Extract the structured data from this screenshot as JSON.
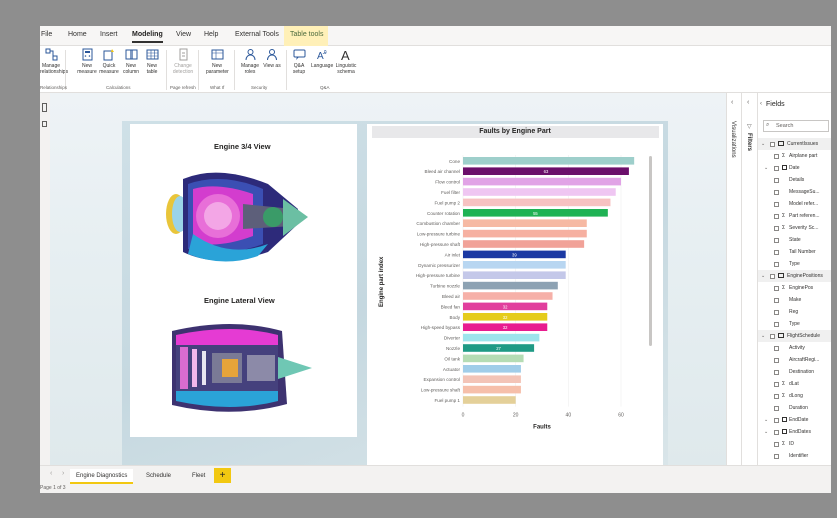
{
  "ribbon": {
    "tabs": [
      "File",
      "Home",
      "Insert",
      "Modeling",
      "View",
      "Help",
      "External Tools",
      "Table tools"
    ],
    "active_tab": "Modeling",
    "buttons": [
      {
        "label": "Manage relationships",
        "icon": "relationships-icon"
      },
      {
        "label": "New measure",
        "icon": "calculator-icon"
      },
      {
        "label": "Quick measure",
        "icon": "quick-measure-icon"
      },
      {
        "label": "New column",
        "icon": "column-icon"
      },
      {
        "label": "New table",
        "icon": "table-icon"
      },
      {
        "label": "Change detection",
        "icon": "change-detection-icon",
        "disabled": true
      },
      {
        "label": "New parameter",
        "icon": "parameter-icon"
      },
      {
        "label": "Manage roles",
        "icon": "roles-icon"
      },
      {
        "label": "View as",
        "icon": "view-as-icon"
      },
      {
        "label": "Q&A setup",
        "icon": "qa-setup-icon"
      },
      {
        "label": "Language",
        "icon": "language-icon"
      },
      {
        "label": "Linguistic schema",
        "icon": "linguistic-schema-icon"
      }
    ],
    "groups": [
      "Relationships",
      "Calculations",
      "Page refresh",
      "What If",
      "Security",
      "Q&A"
    ]
  },
  "report": {
    "left_visual": {
      "title1": "Engine 3/4 View",
      "title2": "Engine Lateral View"
    },
    "chart_data": {
      "type": "bar",
      "orientation": "horizontal",
      "title": "Faults by Engine Part",
      "ylabel": "Engine part index",
      "xlabel": "Faults",
      "xlim": [
        0,
        60
      ],
      "xticks": [
        0,
        20,
        40,
        60
      ],
      "categories": [
        "Cone",
        "Bleed air channel",
        "Flow control",
        "Fuel filter",
        "Fuel pump 2",
        "Counter rotation",
        "Combustion chamber",
        "Low-pressure turbine",
        "High-pressure shaft",
        "Air inlet",
        "Dynamic pressurizer",
        "High-pressure turbine",
        "Turbine nozzle",
        "Bleed air",
        "Bleed fan",
        "Body",
        "High-speed bypass",
        "Diverter",
        "Nozzle",
        "Oil tank",
        "Actuator",
        "Expansion control",
        "Low-pressure shaft",
        "Fuel pump 1"
      ],
      "values": [
        65,
        63,
        60,
        58,
        56,
        55,
        47,
        47,
        46,
        39,
        39,
        39,
        36,
        34,
        32,
        32,
        32,
        29,
        27,
        23,
        22,
        22,
        22,
        20
      ],
      "data_labels": {
        "1": "63",
        "5": "55",
        "9": "39",
        "14": "32",
        "15": "32",
        "16": "32",
        "18": "27"
      },
      "colors": [
        "#9ecfcb",
        "#6b0f6b",
        "#e1a3e6",
        "#efc6f2",
        "#f7c2c2",
        "#1fb254",
        "#f6b9a3",
        "#f6b0a1",
        "#f1a298",
        "#1b39a3",
        "#b8d6f1",
        "#c4c8e9",
        "#8da2b3",
        "#f6b0a8",
        "#e13f9d",
        "#e5cc1c",
        "#e81c8f",
        "#9de4ec",
        "#1f9a85",
        "#b5dcb4",
        "#a0cde9",
        "#f3c4b7",
        "#f6bfaa",
        "#e4d099"
      ]
    }
  },
  "page_tabs": [
    "Engine Diagnostics",
    "Schedule",
    "Fleet"
  ],
  "active_page_tab": "Engine Diagnostics",
  "add_page_label": "+",
  "status": {
    "page_info": "Page 1 of 3"
  },
  "panes": {
    "visualizations": "Visualizations",
    "filters": "Filters"
  },
  "fields": {
    "title": "Fields",
    "search_placeholder": "Search",
    "tables": [
      {
        "name": "CurrentIssues",
        "expanded": true,
        "fields": [
          {
            "name": "Airplane part",
            "kind": "sigma"
          },
          {
            "name": "Date",
            "kind": "date",
            "expanded": true
          },
          {
            "name": "Details",
            "kind": "text"
          },
          {
            "name": "MessageSu...",
            "kind": "text"
          },
          {
            "name": "Model refer...",
            "kind": "text"
          },
          {
            "name": "Part referen...",
            "kind": "sigma"
          },
          {
            "name": "Severity Sc...",
            "kind": "sigma"
          },
          {
            "name": "State",
            "kind": "text"
          },
          {
            "name": "Tail Number",
            "kind": "text"
          },
          {
            "name": "Type",
            "kind": "text"
          }
        ]
      },
      {
        "name": "EnginePositions",
        "expanded": true,
        "fields": [
          {
            "name": "EnginePos",
            "kind": "sigma"
          },
          {
            "name": "Make",
            "kind": "text"
          },
          {
            "name": "Reg",
            "kind": "text"
          },
          {
            "name": "Type",
            "kind": "text"
          }
        ]
      },
      {
        "name": "FlightSchedule",
        "expanded": true,
        "fields": [
          {
            "name": "Activity",
            "kind": "text"
          },
          {
            "name": "AircraftRegi...",
            "kind": "text"
          },
          {
            "name": "Destination",
            "kind": "text"
          },
          {
            "name": "dLat",
            "kind": "sigma"
          },
          {
            "name": "dLong",
            "kind": "sigma"
          },
          {
            "name": "Duration",
            "kind": "text"
          },
          {
            "name": "EndDate",
            "kind": "date",
            "expanded": true
          },
          {
            "name": "EndDates",
            "kind": "date",
            "expanded": true
          },
          {
            "name": "ID",
            "kind": "sigma"
          },
          {
            "name": "Identifier",
            "kind": "text"
          }
        ]
      }
    ]
  }
}
